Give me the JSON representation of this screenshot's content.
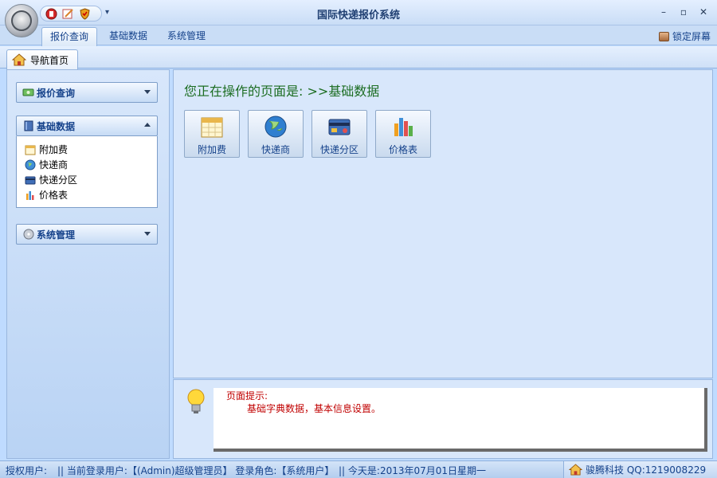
{
  "window": {
    "title": "国际快递报价系统",
    "minimize": "–",
    "maximize": "▫",
    "close": "✕"
  },
  "ribbon": {
    "tabs": [
      "报价查询",
      "基础数据",
      "系统管理"
    ],
    "active_tab": "报价查询",
    "lock_label": "锁定屏幕"
  },
  "doc_tabs": {
    "home_label": "导航首页"
  },
  "nav": {
    "groups": [
      {
        "label": "报价查询",
        "icon": "money-icon",
        "expanded": false,
        "items": []
      },
      {
        "label": "基础数据",
        "icon": "book-icon",
        "expanded": true,
        "items": [
          {
            "label": "附加费",
            "icon": "calendar-icon"
          },
          {
            "label": "快递商",
            "icon": "globe-icon"
          },
          {
            "label": "快递分区",
            "icon": "card-icon"
          },
          {
            "label": "价格表",
            "icon": "barchart-icon"
          }
        ]
      },
      {
        "label": "系统管理",
        "icon": "cd-icon",
        "expanded": false,
        "items": []
      }
    ]
  },
  "main": {
    "heading": "您正在操作的页面是: >>基础数据",
    "tiles": [
      {
        "label": "附加费",
        "icon": "calendar-icon"
      },
      {
        "label": "快递商",
        "icon": "globe-icon"
      },
      {
        "label": "快递分区",
        "icon": "card-icon"
      },
      {
        "label": "价格表",
        "icon": "barchart-icon"
      }
    ]
  },
  "tip": {
    "title": "页面提示:",
    "text": "基础字典数据，基本信息设置。"
  },
  "status": {
    "auth": "授权用户:",
    "user": "|| 当前登录用户:【(Admin)超级管理员】 登录角色:【系统用户】",
    "date": "|| 今天是:2013年07月01日星期一",
    "company": "骏腾科技 QQ:1219008229"
  }
}
